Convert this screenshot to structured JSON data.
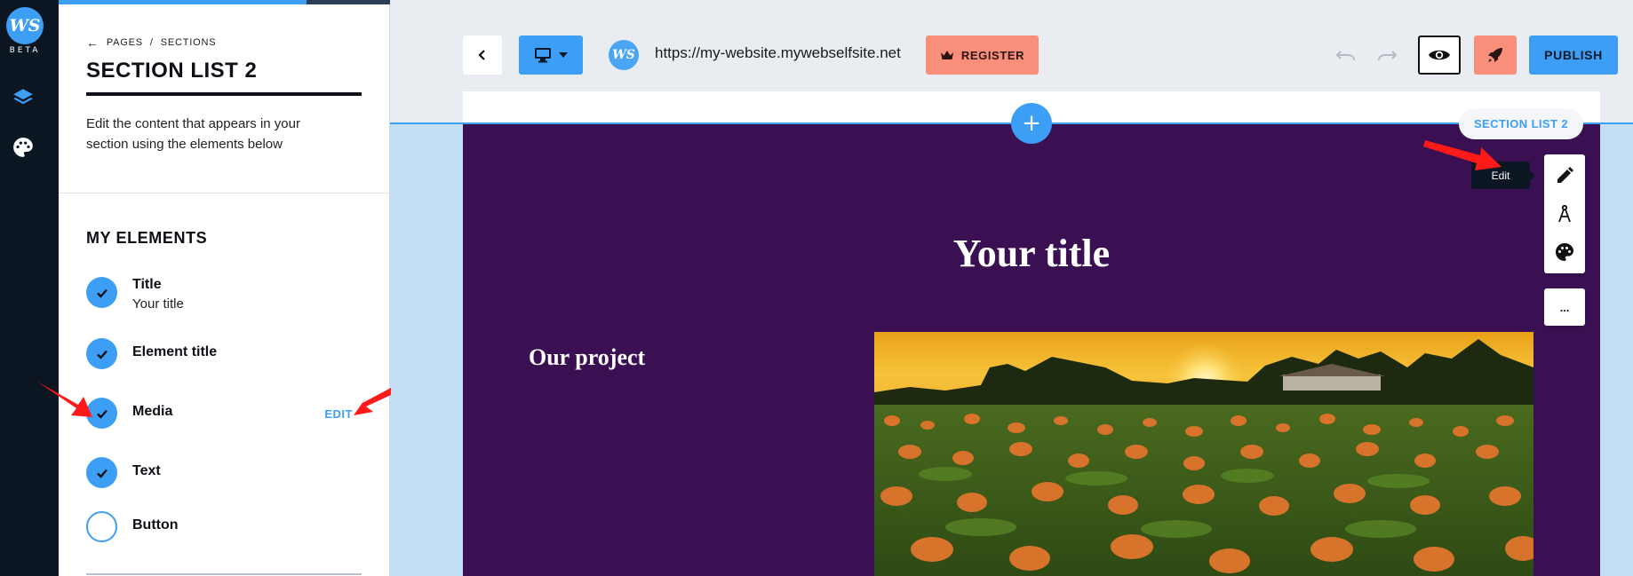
{
  "rail": {
    "logo_text": "WS",
    "beta_label": "BETA",
    "icons": [
      "layers-icon",
      "palette-icon"
    ]
  },
  "panel": {
    "breadcrumb": {
      "pages": "PAGES",
      "separator": "/",
      "sections": "SECTIONS"
    },
    "title": "SECTION LIST 2",
    "description": "Edit the content that appears in your section using the elements below",
    "elements_heading": "MY ELEMENTS",
    "elements": [
      {
        "name": "Title",
        "sub": "Your title",
        "checked": true
      },
      {
        "name": "Element title",
        "checked": true
      },
      {
        "name": "Media",
        "checked": true,
        "edit_label": "EDIT"
      },
      {
        "name": "Text",
        "checked": true
      },
      {
        "name": "Button",
        "checked": false
      }
    ]
  },
  "toolbar": {
    "url": "https://my-website.mywebselfsite.net",
    "site_logo_text": "WS",
    "register_label": "REGISTER",
    "publish_label": "PUBLISH"
  },
  "section": {
    "tag_label": "SECTION LIST 2",
    "add_symbol": "+",
    "title": "Your title",
    "project_title": "Our project",
    "tooltip": "Edit",
    "more_label": "..."
  },
  "colors": {
    "accent": "#3d9ef5",
    "rail": "#0c1622",
    "section_bg": "#3b1052",
    "register": "#f98e7b",
    "annotation_arrow": "#ff0000"
  }
}
